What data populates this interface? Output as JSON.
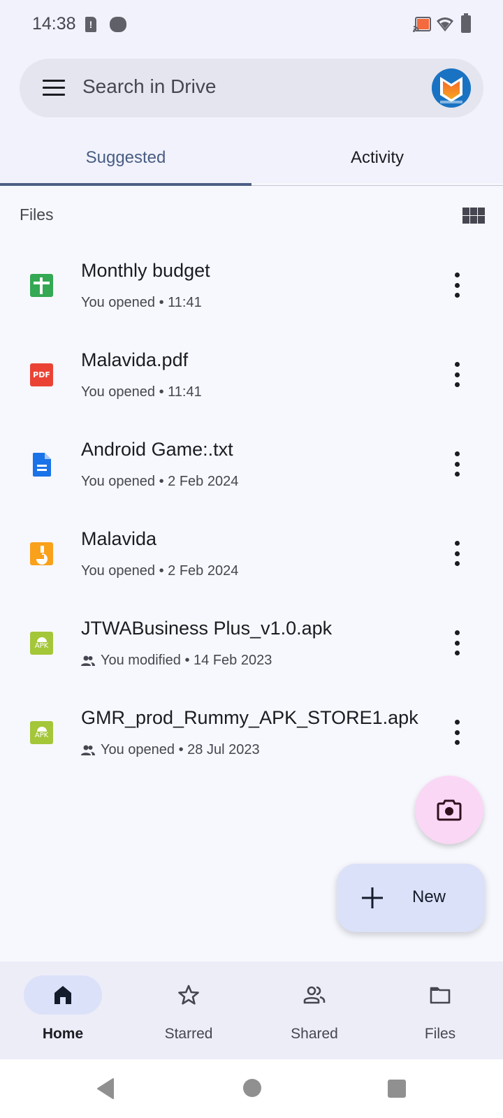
{
  "status_bar": {
    "time": "14:38",
    "sim_alert_glyph": "!",
    "icons": [
      "sim-alert-icon",
      "notification-dot-icon",
      "cast-icon",
      "wifi-icon",
      "battery-icon"
    ]
  },
  "search": {
    "placeholder": "Search in Drive",
    "menu_icon": "hamburger-menu-icon",
    "avatar": "malavida-avatar"
  },
  "tabs": [
    {
      "label": "Suggested",
      "active": true
    },
    {
      "label": "Activity",
      "active": false
    }
  ],
  "files_section": {
    "title": "Files",
    "view_toggle_icon": "grid-view-icon"
  },
  "files": [
    {
      "name": "Monthly budget",
      "action": "You opened",
      "time": "11:41",
      "type": "sheets",
      "shared": false,
      "meta": "You opened • 11:41"
    },
    {
      "name": "Malavida.pdf",
      "action": "You opened",
      "time": "11:41",
      "type": "pdf",
      "shared": false,
      "meta": "You opened • 11:41",
      "icon_text": "PDF"
    },
    {
      "name": "Android Game:.txt",
      "action": "You opened",
      "time": "2 Feb 2024",
      "type": "docs",
      "shared": false,
      "meta": "You opened • 2 Feb 2024"
    },
    {
      "name": "Malavida",
      "action": "You opened",
      "time": "2 Feb 2024",
      "type": "slides",
      "shared": false,
      "meta": "You opened • 2 Feb 2024"
    },
    {
      "name": "JTWABusiness Plus_v1.0.apk",
      "action": "You modified",
      "time": "14 Feb 2023",
      "type": "apk",
      "shared": true,
      "meta": "You modified • 14 Feb 2023",
      "icon_text": "APK"
    },
    {
      "name": "GMR_prod_Rummy_APK_STORE1.apk",
      "action": "You opened",
      "time": "28 Jul 2023",
      "type": "apk",
      "shared": true,
      "meta": "You opened • 28 Jul 2023",
      "icon_text": "APK"
    }
  ],
  "fabs": {
    "camera_icon": "camera-icon",
    "new_label": "New"
  },
  "bottom_nav": [
    {
      "label": "Home",
      "icon": "home-icon",
      "active": true
    },
    {
      "label": "Starred",
      "icon": "star-icon",
      "active": false
    },
    {
      "label": "Shared",
      "icon": "shared-people-icon",
      "active": false
    },
    {
      "label": "Files",
      "icon": "folder-icon",
      "active": false
    }
  ],
  "colors": {
    "accent": "#4c5f85",
    "sheets_green": "#34a853",
    "pdf_red": "#ea4335",
    "docs_blue": "#1a73e8",
    "slides_orange": "#f9a11b",
    "apk_green": "#a4c639",
    "camera_fab": "#fbd7f6",
    "new_fab": "#dbe1f8"
  }
}
